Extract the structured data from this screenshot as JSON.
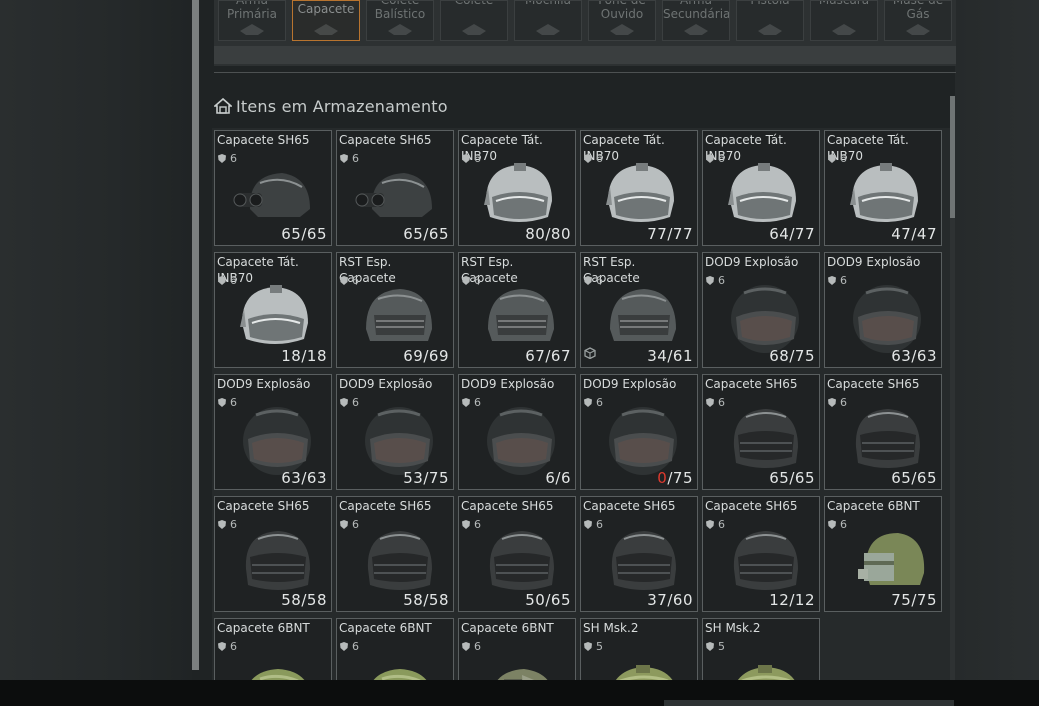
{
  "equipment_slots": [
    {
      "label": "Arma\nPrimária",
      "icon": "rifle-icon",
      "active": false
    },
    {
      "label": "Capacete",
      "icon": "helmet-icon",
      "active": true
    },
    {
      "label": "Colete\nBalístico",
      "icon": "armor-icon",
      "active": false
    },
    {
      "label": "Colete",
      "icon": "vest-icon",
      "active": false
    },
    {
      "label": "Mochila",
      "icon": "backpack-icon",
      "active": false
    },
    {
      "label": "Fone de\nOuvido",
      "icon": "headset-icon",
      "active": false
    },
    {
      "label": "Arma\nSecundária",
      "icon": "secondary-weapon-icon",
      "active": false
    },
    {
      "label": "Pistola",
      "icon": "pistol-icon",
      "active": false
    },
    {
      "label": "Máscara",
      "icon": "mask-icon",
      "active": false
    },
    {
      "label": "Máse de\nGás",
      "icon": "gas-mask-icon",
      "active": false
    }
  ],
  "storage": {
    "title": "Itens em Armazenamento",
    "icon": "home-storage-icon"
  },
  "colors": {
    "accent": "#b8742f",
    "low_durability": "#e03a2e",
    "card_border": "#5a5f60"
  },
  "items": [
    {
      "name": "Capacete SH65",
      "tier": "6",
      "cur": "65",
      "max": "65",
      "type": "sh65nv"
    },
    {
      "name": "Capacete SH65",
      "tier": "6",
      "cur": "65",
      "max": "65",
      "type": "sh65nv"
    },
    {
      "name": "Capacete Tát. INB70",
      "tier": "6",
      "cur": "80",
      "max": "80",
      "type": "tac"
    },
    {
      "name": "Capacete Tát. INB70",
      "tier": "6",
      "cur": "77",
      "max": "77",
      "type": "tac"
    },
    {
      "name": "Capacete Tát. INB70",
      "tier": "6",
      "cur": "64",
      "max": "77",
      "type": "tac"
    },
    {
      "name": "Capacete Tát. INB70",
      "tier": "6",
      "cur": "47",
      "max": "47",
      "type": "tac"
    },
    {
      "name": "Capacete Tát. INB70",
      "tier": "6",
      "cur": "18",
      "max": "18",
      "type": "tac"
    },
    {
      "name": "RST Esp. Capacete",
      "tier": "6",
      "cur": "69",
      "max": "69",
      "type": "rst"
    },
    {
      "name": "RST Esp. Capacete",
      "tier": "6",
      "cur": "67",
      "max": "67",
      "type": "rst"
    },
    {
      "name": "RST Esp. Capacete",
      "tier": "6",
      "cur": "34",
      "max": "61",
      "type": "rst",
      "package": true
    },
    {
      "name": "DOD9 Explosão",
      "tier": "6",
      "cur": "68",
      "max": "75",
      "type": "dod"
    },
    {
      "name": "DOD9 Explosão",
      "tier": "6",
      "cur": "63",
      "max": "63",
      "type": "dod"
    },
    {
      "name": "DOD9 Explosão",
      "tier": "6",
      "cur": "63",
      "max": "63",
      "type": "dod"
    },
    {
      "name": "DOD9 Explosão",
      "tier": "6",
      "cur": "53",
      "max": "75",
      "type": "dod"
    },
    {
      "name": "DOD9 Explosão",
      "tier": "6",
      "cur": "6",
      "max": "6",
      "type": "dod"
    },
    {
      "name": "DOD9 Explosão",
      "tier": "6",
      "cur": "0",
      "max": "75",
      "type": "dod",
      "low": true
    },
    {
      "name": "Capacete SH65",
      "tier": "6",
      "cur": "65",
      "max": "65",
      "type": "sh65"
    },
    {
      "name": "Capacete SH65",
      "tier": "6",
      "cur": "65",
      "max": "65",
      "type": "sh65"
    },
    {
      "name": "Capacete SH65",
      "tier": "6",
      "cur": "58",
      "max": "58",
      "type": "sh65"
    },
    {
      "name": "Capacete SH65",
      "tier": "6",
      "cur": "58",
      "max": "58",
      "type": "sh65"
    },
    {
      "name": "Capacete SH65",
      "tier": "6",
      "cur": "50",
      "max": "65",
      "type": "sh65"
    },
    {
      "name": "Capacete SH65",
      "tier": "6",
      "cur": "37",
      "max": "60",
      "type": "sh65"
    },
    {
      "name": "Capacete SH65",
      "tier": "6",
      "cur": "12",
      "max": "12",
      "type": "sh65"
    },
    {
      "name": "Capacete 6BNT",
      "tier": "6",
      "cur": "75",
      "max": "75",
      "type": "bnt"
    },
    {
      "name": "Capacete 6BNT",
      "tier": "6",
      "cur": "",
      "max": "",
      "type": "bntg"
    },
    {
      "name": "Capacete 6BNT",
      "tier": "6",
      "cur": "",
      "max": "",
      "type": "bntg"
    },
    {
      "name": "Capacete 6BNT",
      "tier": "6",
      "cur": "",
      "max": "",
      "type": "bntc"
    },
    {
      "name": "SH Msk.2",
      "tier": "5",
      "cur": "",
      "max": "",
      "type": "msk"
    },
    {
      "name": "SH Msk.2",
      "tier": "5",
      "cur": "",
      "max": "",
      "type": "msk"
    }
  ]
}
